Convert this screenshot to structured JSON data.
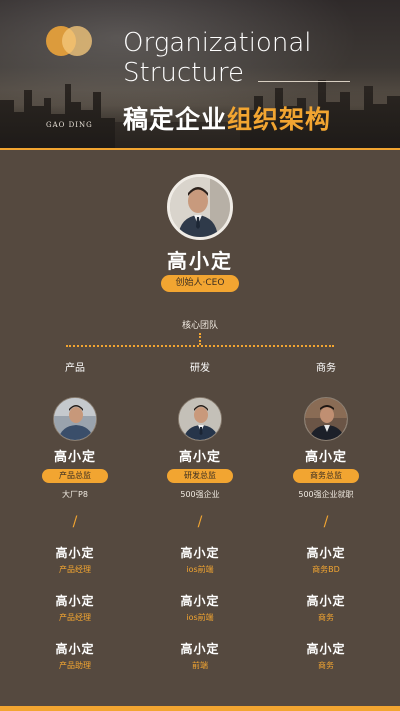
{
  "header": {
    "brand": "GAO DING",
    "title_en_line1": "Organizational",
    "title_en_line2": "Structure",
    "title_cn_main": "稿定企业",
    "title_cn_accent": "组织架构"
  },
  "ceo": {
    "name": "高小定",
    "title": "创始人·CEO"
  },
  "core_label": "核心团队",
  "columns": [
    {
      "head": "产品",
      "lead_name": "高小定",
      "lead_role": "产品总监",
      "lead_note": "大厂P8",
      "members": [
        {
          "name": "高小定",
          "role": "产品经理"
        },
        {
          "name": "高小定",
          "role": "产品经理"
        },
        {
          "name": "高小定",
          "role": "产品助理"
        }
      ]
    },
    {
      "head": "研发",
      "lead_name": "高小定",
      "lead_role": "研发总监",
      "lead_note": "500强企业",
      "members": [
        {
          "name": "高小定",
          "role": "ios前端"
        },
        {
          "name": "高小定",
          "role": "ios前端"
        },
        {
          "name": "高小定",
          "role": "前端"
        }
      ]
    },
    {
      "head": "商务",
      "lead_name": "高小定",
      "lead_role": "商务总监",
      "lead_note": "500强企业就职",
      "members": [
        {
          "name": "高小定",
          "role": "商务BD"
        },
        {
          "name": "高小定",
          "role": "商务"
        },
        {
          "name": "高小定",
          "role": "商务"
        }
      ]
    }
  ],
  "separator": "/",
  "colors": {
    "accent": "#f2a531",
    "background": "#55493f"
  }
}
